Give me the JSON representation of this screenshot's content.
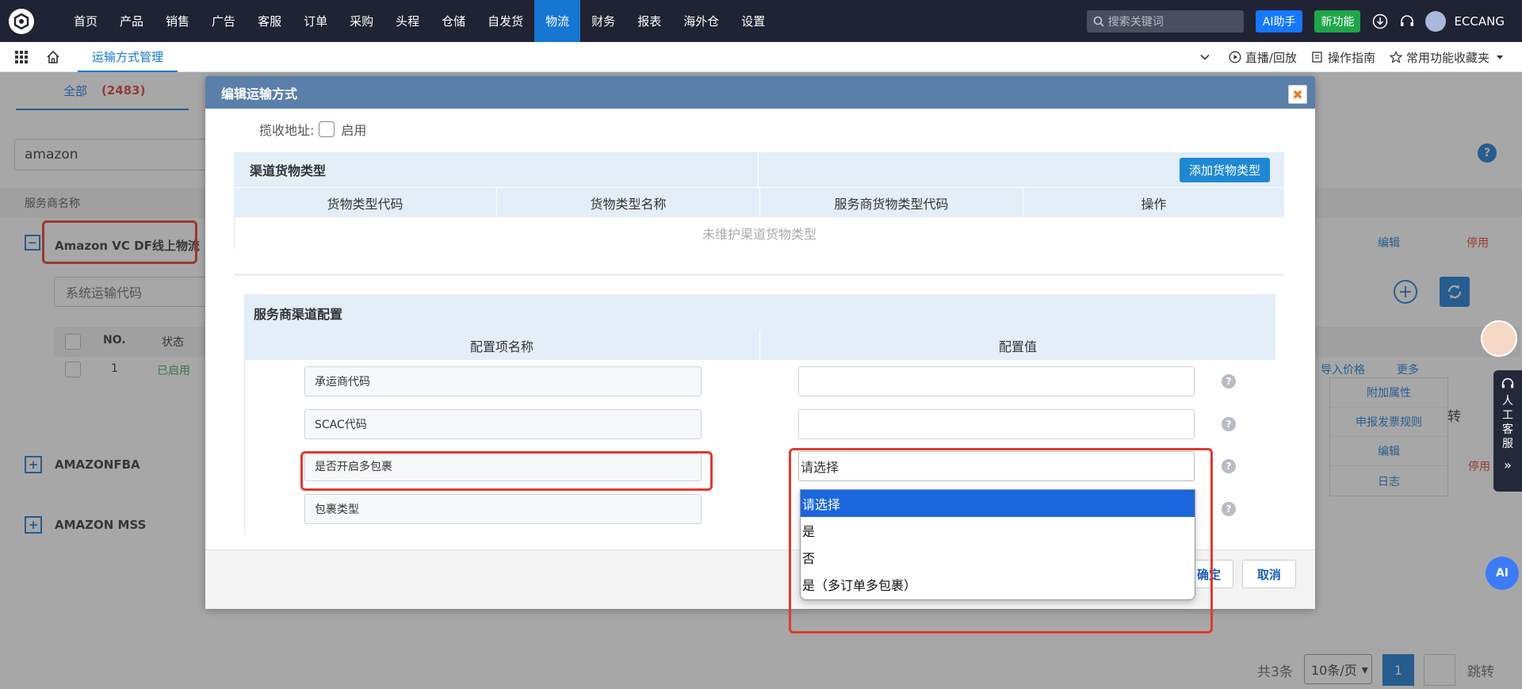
{
  "topnav": {
    "menu": [
      "首页",
      "产品",
      "销售",
      "广告",
      "客服",
      "订单",
      "采购",
      "头程",
      "仓储",
      "自发货",
      "物流",
      "财务",
      "报表",
      "海外仓",
      "设置"
    ],
    "active_index": 10,
    "search_placeholder": "搜索关键词",
    "ai_button": "AI助手",
    "new_button": "新功能",
    "username": "ECCANG"
  },
  "subbar": {
    "current_tab": "运输方式管理",
    "live": "直播/回放",
    "guide": "操作指南",
    "favorites": "常用功能收藏夹"
  },
  "background": {
    "tab_all": "全部",
    "tab_all_count": "(2483)",
    "search_value": "amazon",
    "col_provider": "服务商名称",
    "group1": "Amazon VC DF线上物流（",
    "select_placeholder": "系统运输代码",
    "col_no": "NO.",
    "col_status": "状态",
    "row_no": "1",
    "row_status": "已启用",
    "group2": "AMAZONFBA",
    "group3": "AMAZON MSS",
    "edit": "编辑",
    "disable": "停用",
    "import_price": "导入价格",
    "more": "更多",
    "menu_extra": [
      "附加属性",
      "申报发票规则",
      "编辑",
      "日志"
    ],
    "turn": "转",
    "total": "共3条",
    "page_size": "10条/页",
    "page": "1",
    "jump": "跳转",
    "human_service": "人工客服",
    "ai_badge": "AI"
  },
  "dialog": {
    "title": "编辑运输方式",
    "pickup_label": "揽收地址:",
    "pickup_enable": "启用",
    "cargo_section": "渠道货物类型",
    "add_cargo_button": "添加货物类型",
    "cargo_headers": [
      "货物类型代码",
      "货物类型名称",
      "服务商货物类型代码",
      "操作"
    ],
    "cargo_empty": "未维护渠道货物类型",
    "provider_section": "服务商渠道配置",
    "config_headers": [
      "配置项名称",
      "配置值"
    ],
    "config_rows": [
      {
        "name": "承运商代码",
        "value": ""
      },
      {
        "name": "SCAC代码",
        "value": ""
      },
      {
        "name": "是否开启多包裹",
        "value": "请选择"
      },
      {
        "name": "包裹类型",
        "value": ""
      }
    ],
    "help": "?",
    "ok": "确定",
    "cancel": "取消"
  },
  "dropdown": {
    "options": [
      "请选择",
      "是",
      "否",
      "是（多订单多包裹）"
    ],
    "selected_index": 0
  },
  "colors": {
    "nav_bg": "#1f2333",
    "accent": "#1677d2",
    "dialog_header": "#5a7fa9",
    "highlight_red": "#e03a2e",
    "option_selected": "#1a66dd"
  }
}
